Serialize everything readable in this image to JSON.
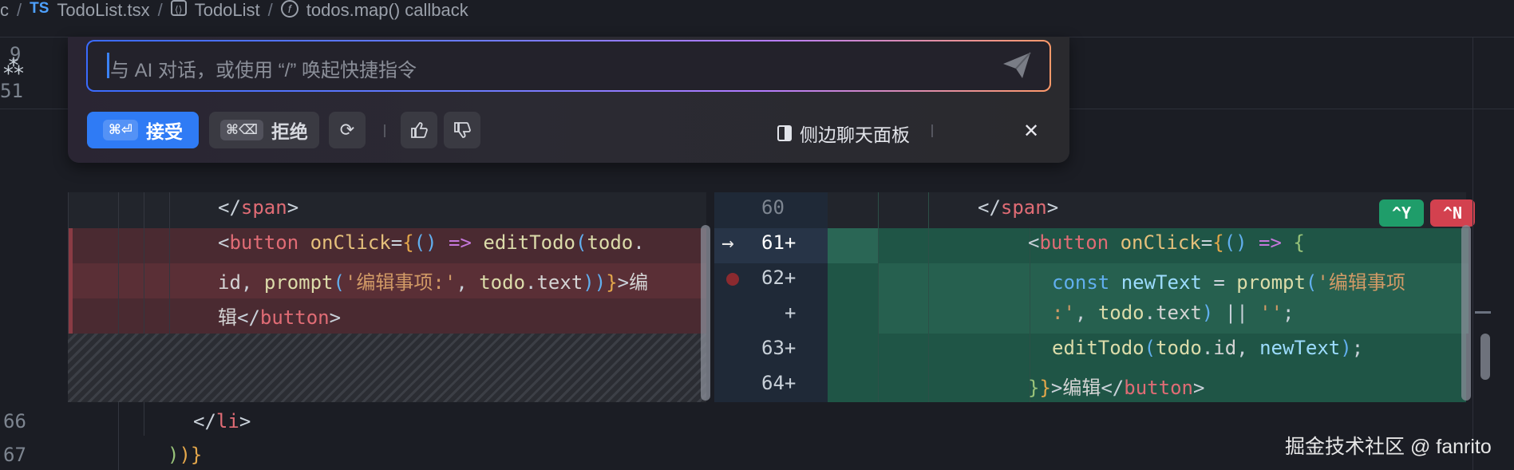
{
  "breadcrumb": {
    "prefix": "c",
    "file_badge": "TS",
    "file": "TodoList.tsx",
    "component": "TodoList",
    "fn_badge": "f",
    "callback": "todos.map() callback"
  },
  "gutter_top": {
    "line_a": "9",
    "line_b": "51"
  },
  "chat": {
    "placeholder": "与 AI 对话，或使用 “/” 唤起快捷指令",
    "accept_kbd": "⌘⏎",
    "accept_label": "接受",
    "reject_kbd": "⌘⌫",
    "reject_label": "拒绝",
    "side_panel_label": "侧边聊天面板",
    "close_glyph": "✕"
  },
  "diff_tags": {
    "accept": "^Y",
    "reject": "^N"
  },
  "center_gutter": [
    {
      "num": "60",
      "marker": ""
    },
    {
      "num": "61",
      "marker": "+"
    },
    {
      "num": "62",
      "marker": "+"
    },
    {
      "num": "",
      "marker": "+"
    },
    {
      "num": "63",
      "marker": "+"
    },
    {
      "num": "64",
      "marker": "+"
    }
  ],
  "bottom_lines": {
    "line_66": "66",
    "line_67": "67"
  },
  "code_text": {
    "span_close": "span",
    "button": "button",
    "onClick": "onClick",
    "editTodo": "editTodo",
    "todo": "todo",
    "id": "id",
    "prompt": "prompt",
    "prompt_str": "'编辑事项:'",
    "text": "text",
    "label_edit": "编辑",
    "label_edit_a": "编",
    "label_edit_b": "辑",
    "const": "const",
    "newText": "newText",
    "str_part1": "'编辑事项",
    "str_part2": ":'",
    "empty_str": "''",
    "li": "li"
  },
  "watermark": "掘金技术社区 @ fanrito"
}
